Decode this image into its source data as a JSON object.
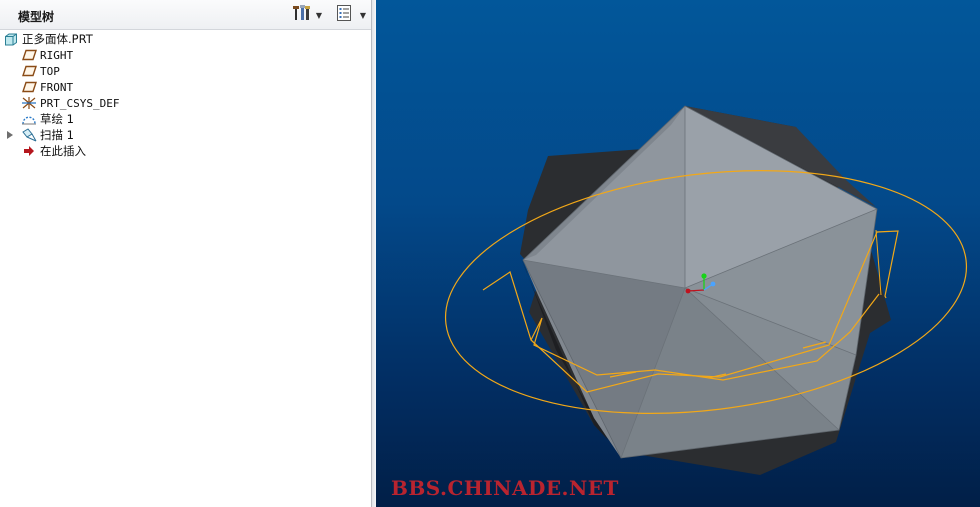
{
  "model_tree": {
    "title": "模型树",
    "root": "正多面体.PRT",
    "items": [
      {
        "label": "RIGHT",
        "icon": "datum-plane-icon"
      },
      {
        "label": "TOP",
        "icon": "datum-plane-icon"
      },
      {
        "label": "FRONT",
        "icon": "datum-plane-icon"
      },
      {
        "label": "PRT_CSYS_DEF",
        "icon": "coordinate-system-icon"
      },
      {
        "label": "草绘 1",
        "icon": "sketch-icon"
      },
      {
        "label": "扫描 1",
        "icon": "sweep-icon"
      },
      {
        "label": "在此插入",
        "icon": "insert-here-arrow-icon"
      }
    ],
    "header_icons": [
      "settings-tools-icon",
      "show-list-icon"
    ]
  },
  "viewport": {
    "watermark": "BBS.CHINADE.NET",
    "colors": {
      "background_top": "#02579a",
      "background_bottom": "#011f47",
      "solid_face": "#8e969e",
      "solid_dark": "#2b2d30",
      "sketch": "#f2a818",
      "insert_arrow": "#b5171e"
    }
  }
}
